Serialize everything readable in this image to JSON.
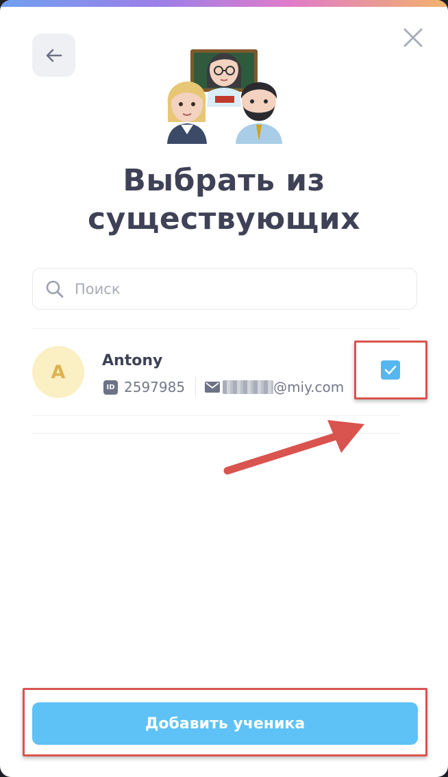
{
  "dialog": {
    "title": "Выбрать из существующих",
    "back_icon": "arrow-left-icon",
    "close_icon": "close-icon",
    "hero_icon": "teachers-emoji-icon"
  },
  "search": {
    "placeholder": "Поиск",
    "value": "",
    "icon": "search-icon"
  },
  "students": [
    {
      "initial": "A",
      "name": "Antony",
      "id_badge": "ID",
      "id": "2597985",
      "email_visible": "@miy.com",
      "email_redacted": true,
      "selected": true
    }
  ],
  "actions": {
    "add_label": "Добавить ученика"
  },
  "colors": {
    "accent": "#5ec2f7",
    "checkbox": "#56b6f0",
    "title": "#3f4256",
    "annotation": "#d9534f",
    "avatar_bg": "#fbefc4"
  }
}
